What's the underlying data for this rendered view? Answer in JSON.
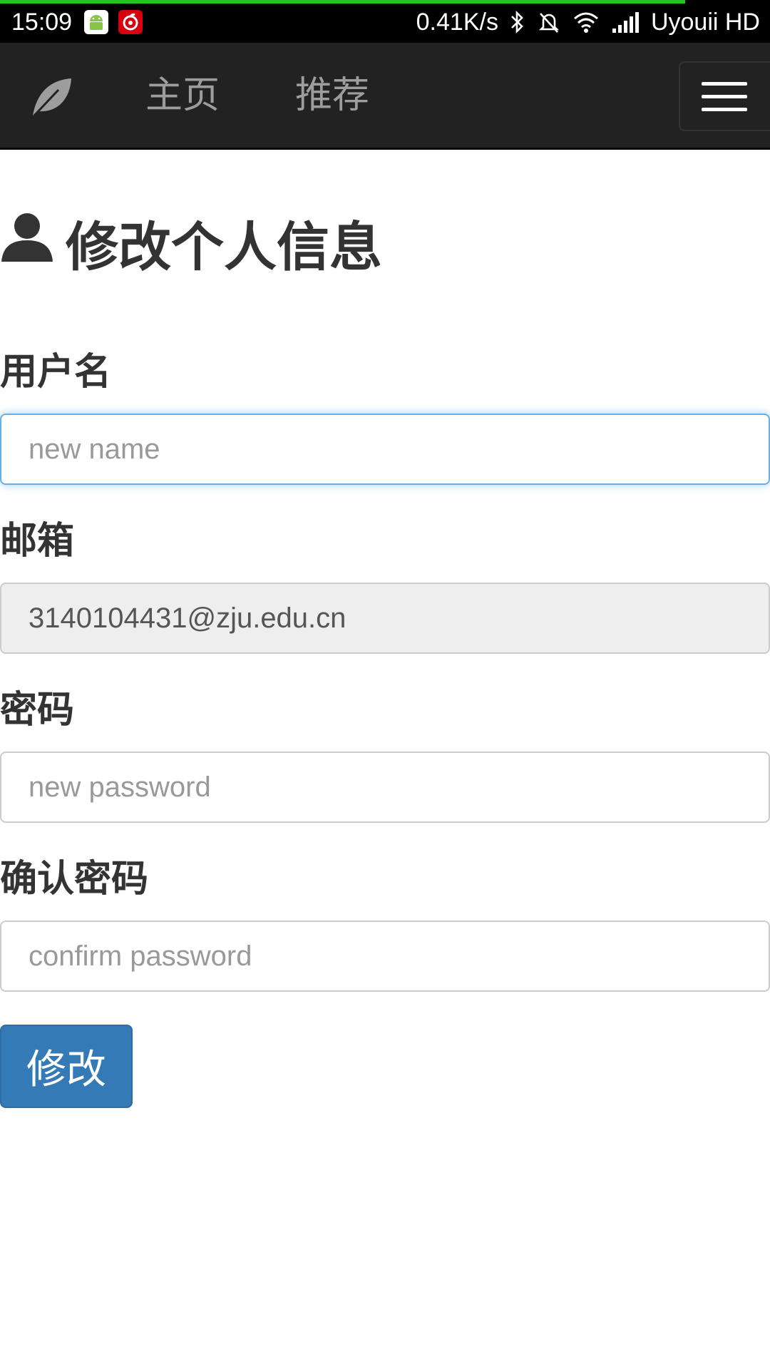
{
  "status_bar": {
    "time": "15:09",
    "net_speed": "0.41K/s",
    "carrier": "Uyouii HD",
    "progress": 0.89,
    "icons": [
      "android-icon",
      "netease-music-icon",
      "bluetooth-icon",
      "mute-icon",
      "wifi-icon",
      "signal-icon"
    ]
  },
  "navbar": {
    "brand_icon": "leaf-icon",
    "items": [
      {
        "label": "主页"
      },
      {
        "label": "推荐"
      }
    ],
    "toggle_icon": "menu-icon"
  },
  "page": {
    "title": "修改个人信息",
    "title_icon": "user-icon"
  },
  "form": {
    "username": {
      "label": "用户名",
      "placeholder": "new name",
      "value": ""
    },
    "email": {
      "label": "邮箱",
      "value": "3140104431@zju.edu.cn"
    },
    "password": {
      "label": "密码",
      "placeholder": "new password",
      "value": ""
    },
    "confirm_password": {
      "label": "确认密码",
      "placeholder": "confirm password",
      "value": ""
    },
    "submit_label": "修改"
  },
  "colors": {
    "navbar_bg": "#222222",
    "primary": "#337ab7",
    "focus_border": "#66afe9",
    "status_progress": "#22c51f"
  }
}
